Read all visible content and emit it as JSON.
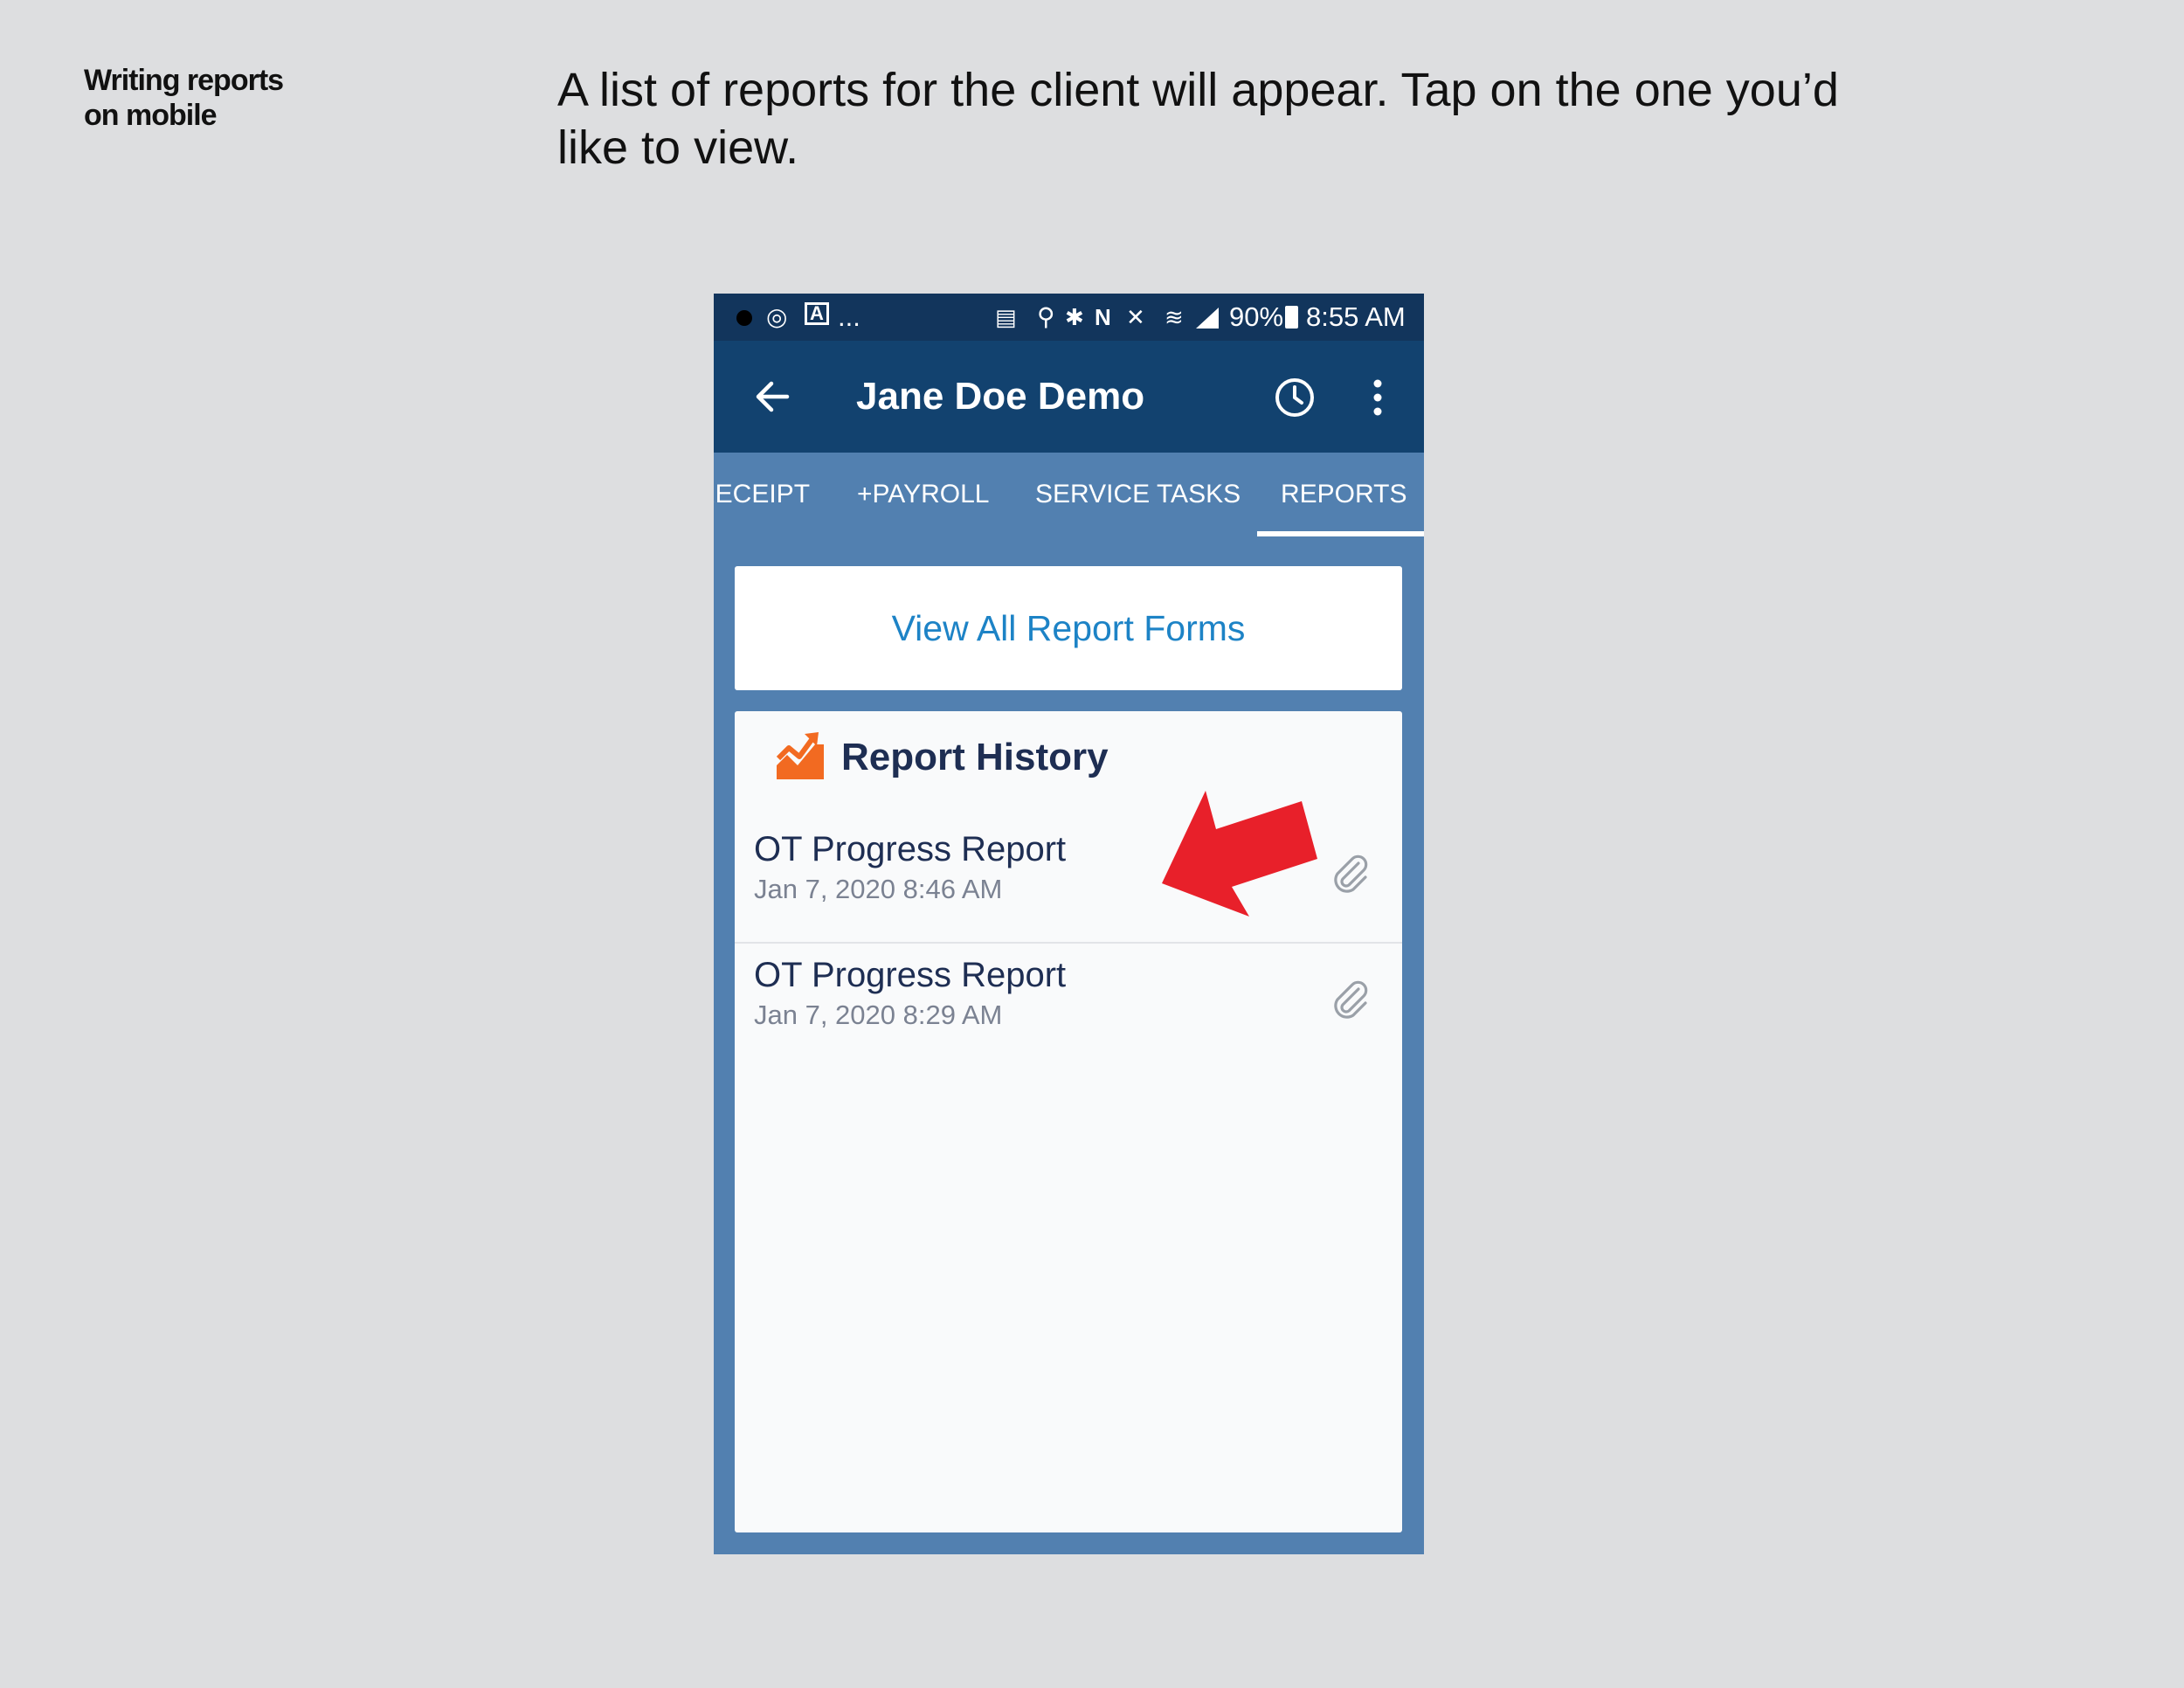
{
  "page": {
    "section_label_line1": "Writing reports",
    "section_label_line2": "on mobile",
    "instruction_line1": "A list of reports for the client will appear. Tap on the one you’d",
    "instruction_line2": "like to view."
  },
  "status_bar": {
    "ellipsis": "...",
    "battery": "90%",
    "time": "8:55 AM"
  },
  "app_bar": {
    "title": "Jane Doe Demo"
  },
  "tabs": [
    {
      "label": "RECEIPT"
    },
    {
      "label": "+PAYROLL"
    },
    {
      "label": "SERVICE TASKS"
    },
    {
      "label": "REPORTS",
      "active": true
    }
  ],
  "view_all": {
    "label": "View All Report Forms"
  },
  "history": {
    "title": "Report History",
    "items": [
      {
        "name": "OT Progress Report",
        "date": "Jan 7, 2020 8:46 AM"
      },
      {
        "name": "OT Progress Report",
        "date": "Jan 7, 2020 8:29 AM"
      }
    ]
  },
  "colors": {
    "status_bar": "#12355c",
    "app_bar": "#12426f",
    "tab_bar": "#5280b0",
    "link": "#1d83c6",
    "history_icon": "#f26a21",
    "callout_arrow": "#e8202a"
  },
  "icons": {
    "back": "arrow-left-icon",
    "history": "clock-icon",
    "more": "more-vertical-icon",
    "report_history": "growth-chart-icon",
    "attachment": "paperclip-icon",
    "callout": "red-arrow-icon"
  }
}
